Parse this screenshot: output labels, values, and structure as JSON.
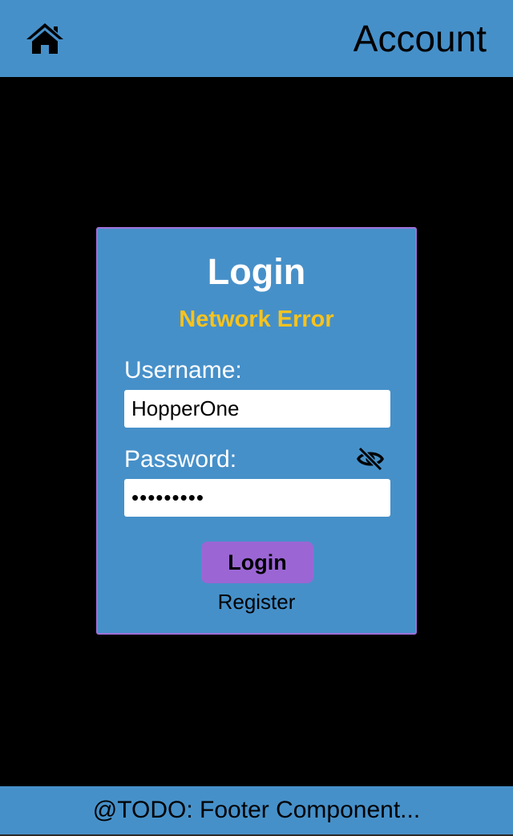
{
  "header": {
    "title": "Account",
    "home_icon": "home-icon"
  },
  "login_card": {
    "title": "Login",
    "error_message": "Network Error",
    "username_label": "Username:",
    "username_value": "HopperOne",
    "password_label": "Password:",
    "password_value": "•••••••••",
    "visibility_icon": "eye-slash-icon",
    "login_button_label": "Login",
    "register_link_label": "Register"
  },
  "footer": {
    "text": "@TODO: Footer Component..."
  },
  "colors": {
    "primary": "#4690c9",
    "background": "#000000",
    "error": "#f7c31e",
    "button": "#9b66d4",
    "card_border": "#a070d8"
  }
}
